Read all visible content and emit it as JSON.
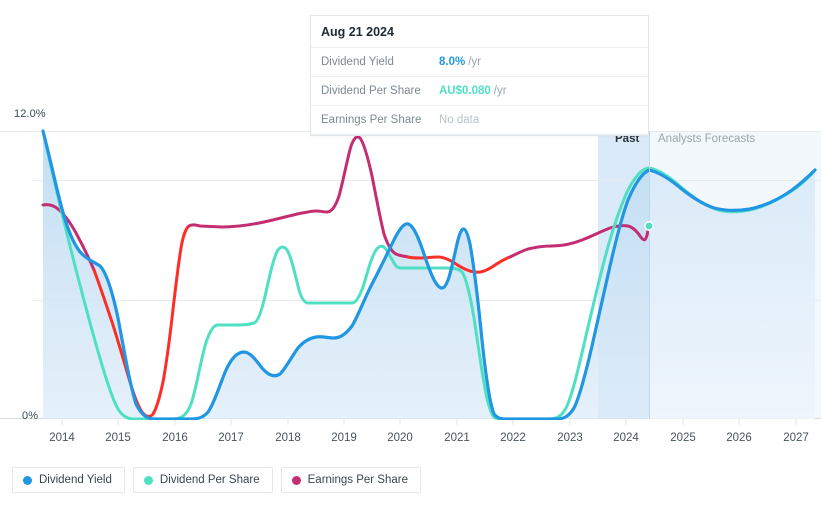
{
  "tooltip": {
    "title": "Aug 21 2024",
    "rows": [
      {
        "label": "Dividend Yield",
        "value": "8.0%",
        "unit": "/yr",
        "color": "#2196e3",
        "nodata": false
      },
      {
        "label": "Dividend Per Share",
        "value": "AU$0.080",
        "unit": "/yr",
        "color": "#4fe0c4",
        "nodata": false
      },
      {
        "label": "Earnings Per Share",
        "value": "No data",
        "unit": "",
        "color": "#b9c1c7",
        "nodata": true
      }
    ]
  },
  "axis": {
    "y_labels": [
      "12.0%",
      "0%"
    ],
    "y_top_label": "12.0%",
    "y_bottom_label": "0%",
    "x_labels": [
      "2014",
      "2015",
      "2016",
      "2017",
      "2018",
      "2019",
      "2020",
      "2021",
      "2022",
      "2023",
      "2024",
      "2025",
      "2026",
      "2027"
    ]
  },
  "bands": {
    "past_label": "Past",
    "forecast_label": "Analysts Forecasts"
  },
  "legend": [
    {
      "label": "Dividend Yield",
      "color": "#2196e3"
    },
    {
      "label": "Dividend Per Share",
      "color": "#4fe0c4"
    },
    {
      "label": "Earnings Per Share",
      "color": "#c42d72"
    }
  ],
  "colors": {
    "dividend_yield": "#2196e3",
    "dividend_per_share": "#4fe0c4",
    "earnings_per_share": "#c42d72",
    "earnings_negative": "#fc2f28",
    "area_fill": "#cfe4f5",
    "forecast_fill": "#eaf3fb",
    "past_band": "#dbeaf8",
    "grid": "#e8ebed"
  },
  "chart_data": {
    "type": "line",
    "title": "Dividend Yield, Dividend Per Share and Earnings Per Share history and forecast",
    "xlabel": "",
    "ylabel": "",
    "ylim": [
      0,
      12
    ],
    "xlim": [
      2013.6,
      2027.6
    ],
    "grid": true,
    "legend_position": "bottom-left",
    "y_tick_values": [
      0,
      12
    ],
    "y_tick_labels": [
      "0%",
      "12.0%"
    ],
    "x_tick_values": [
      2014,
      2015,
      2016,
      2017,
      2018,
      2019,
      2020,
      2021,
      2022,
      2023,
      2024,
      2025,
      2026,
      2027
    ],
    "past_forecast_split_x": 2024.64,
    "highlight_band": [
      2023.4,
      2024.64
    ],
    "cursor_marker": {
      "x": 2024.64,
      "y": 8.0,
      "label": "Aug 21 2024"
    },
    "series": [
      {
        "name": "Dividend Yield",
        "color": "#2196e3",
        "unit": "%",
        "points": [
          [
            2013.62,
            12.0
          ],
          [
            2014.0,
            9.85
          ],
          [
            2014.35,
            8.3
          ],
          [
            2014.6,
            7.35
          ],
          [
            2014.85,
            7.0
          ],
          [
            2015.0,
            6.95
          ],
          [
            2015.2,
            6.3
          ],
          [
            2015.45,
            4.0
          ],
          [
            2015.62,
            1.6
          ],
          [
            2015.75,
            0.0
          ],
          [
            2016.0,
            0.0
          ],
          [
            2016.4,
            0.0
          ],
          [
            2016.7,
            0.0
          ],
          [
            2016.85,
            1.4
          ],
          [
            2017.0,
            2.6
          ],
          [
            2017.25,
            3.0
          ],
          [
            2017.45,
            2.75
          ],
          [
            2017.7,
            2.2
          ],
          [
            2017.9,
            2.1
          ],
          [
            2018.1,
            2.6
          ],
          [
            2018.4,
            3.5
          ],
          [
            2018.7,
            4.0
          ],
          [
            2019.0,
            4.05
          ],
          [
            2019.3,
            3.85
          ],
          [
            2019.6,
            3.9
          ],
          [
            2019.9,
            4.6
          ],
          [
            2020.1,
            5.9
          ],
          [
            2020.3,
            6.9
          ],
          [
            2020.45,
            7.1
          ],
          [
            2020.6,
            6.35
          ],
          [
            2020.8,
            5.4
          ],
          [
            2020.95,
            5.35
          ],
          [
            2021.1,
            6.6
          ],
          [
            2021.25,
            8.3
          ],
          [
            2021.4,
            7.3
          ],
          [
            2021.6,
            4.6
          ],
          [
            2021.8,
            1.7
          ],
          [
            2021.95,
            0.0
          ],
          [
            2022.3,
            0.0
          ],
          [
            2022.8,
            0.0
          ],
          [
            2023.1,
            0.0
          ],
          [
            2023.35,
            0.7
          ],
          [
            2023.7,
            2.5
          ],
          [
            2024.0,
            4.6
          ],
          [
            2024.3,
            6.6
          ],
          [
            2024.5,
            7.6
          ],
          [
            2024.64,
            8.0
          ],
          [
            2024.9,
            7.6
          ],
          [
            2025.2,
            7.0
          ],
          [
            2025.5,
            6.75
          ],
          [
            2025.9,
            6.7
          ],
          [
            2026.3,
            6.85
          ],
          [
            2026.7,
            7.2
          ],
          [
            2027.1,
            7.7
          ],
          [
            2027.45,
            8.25
          ]
        ]
      },
      {
        "name": "Dividend Per Share",
        "color": "#4fe0c4",
        "unit": "AU$",
        "points": [
          [
            2013.62,
            12.0
          ],
          [
            2014.0,
            10.3
          ],
          [
            2014.4,
            8.4
          ],
          [
            2014.8,
            6.6
          ],
          [
            2015.2,
            4.6
          ],
          [
            2015.5,
            3.0
          ],
          [
            2015.8,
            1.2
          ],
          [
            2016.0,
            0.0
          ],
          [
            2016.4,
            0.0
          ],
          [
            2016.7,
            0.0
          ],
          [
            2016.85,
            1.1
          ],
          [
            2017.0,
            2.6
          ],
          [
            2017.2,
            3.3
          ],
          [
            2017.5,
            3.35
          ],
          [
            2017.8,
            3.35
          ],
          [
            2018.0,
            4.2
          ],
          [
            2018.25,
            5.6
          ],
          [
            2018.45,
            5.6
          ],
          [
            2018.65,
            4.6
          ],
          [
            2018.9,
            3.85
          ],
          [
            2019.2,
            3.85
          ],
          [
            2019.5,
            3.85
          ],
          [
            2019.7,
            4.7
          ],
          [
            2019.9,
            5.7
          ],
          [
            2020.2,
            5.75
          ],
          [
            2020.6,
            5.75
          ],
          [
            2021.0,
            5.75
          ],
          [
            2021.4,
            5.75
          ],
          [
            2021.6,
            4.4
          ],
          [
            2021.8,
            2.0
          ],
          [
            2022.0,
            0.0
          ],
          [
            2022.5,
            0.0
          ],
          [
            2023.0,
            0.0
          ],
          [
            2023.3,
            0.5
          ],
          [
            2023.6,
            2.0
          ],
          [
            2024.0,
            4.6
          ],
          [
            2024.3,
            6.7
          ],
          [
            2024.5,
            7.7
          ],
          [
            2024.64,
            8.05
          ],
          [
            2024.95,
            7.5
          ],
          [
            2025.3,
            6.95
          ],
          [
            2025.7,
            6.8
          ],
          [
            2026.1,
            6.9
          ],
          [
            2026.5,
            7.1
          ],
          [
            2026.9,
            7.45
          ],
          [
            2027.25,
            7.9
          ],
          [
            2027.45,
            8.35
          ]
        ]
      },
      {
        "name": "Earnings Per Share",
        "color": "#c42d72",
        "unit": "AU$",
        "points": [
          [
            2013.62,
            8.85
          ],
          [
            2013.9,
            8.55
          ],
          [
            2014.15,
            7.95
          ],
          [
            2014.4,
            7.0
          ],
          [
            2014.65,
            5.85
          ],
          [
            2014.9,
            4.2
          ],
          [
            2015.1,
            2.35
          ],
          [
            2015.3,
            0.95
          ],
          [
            2015.45,
            0.35
          ],
          [
            2015.6,
            0.7
          ],
          [
            2015.75,
            2.1
          ],
          [
            2015.95,
            4.0
          ],
          [
            2016.1,
            6.1
          ],
          [
            2016.2,
            7.1
          ],
          [
            2016.35,
            7.15
          ],
          [
            2016.7,
            7.05
          ],
          [
            2017.0,
            7.0
          ],
          [
            2017.4,
            7.15
          ],
          [
            2017.8,
            7.3
          ],
          [
            2018.2,
            7.5
          ],
          [
            2018.55,
            7.6
          ],
          [
            2018.75,
            7.6
          ],
          [
            2018.9,
            8.7
          ],
          [
            2019.05,
            10.4
          ],
          [
            2019.15,
            10.85
          ],
          [
            2019.3,
            10.3
          ],
          [
            2019.55,
            8.8
          ],
          [
            2019.8,
            7.0
          ],
          [
            2020.0,
            6.05
          ],
          [
            2020.2,
            5.95
          ],
          [
            2020.45,
            6.05
          ],
          [
            2020.7,
            6.1
          ],
          [
            2020.85,
            5.75
          ],
          [
            2021.0,
            5.35
          ],
          [
            2021.2,
            5.3
          ],
          [
            2021.5,
            5.5
          ],
          [
            2021.7,
            5.7
          ],
          [
            2021.9,
            6.25
          ],
          [
            2022.1,
            6.5
          ],
          [
            2022.5,
            6.55
          ],
          [
            2022.9,
            6.7
          ],
          [
            2023.3,
            7.0
          ],
          [
            2023.7,
            7.25
          ],
          [
            2024.0,
            7.4
          ],
          [
            2024.2,
            7.45
          ],
          [
            2024.45,
            7.15
          ],
          [
            2024.64,
            7.95
          ]
        ],
        "negative_segments": [
          [
            2014.75,
            2016.25
          ],
          [
            2020.0,
            2021.95
          ]
        ],
        "forecast": false
      }
    ]
  }
}
